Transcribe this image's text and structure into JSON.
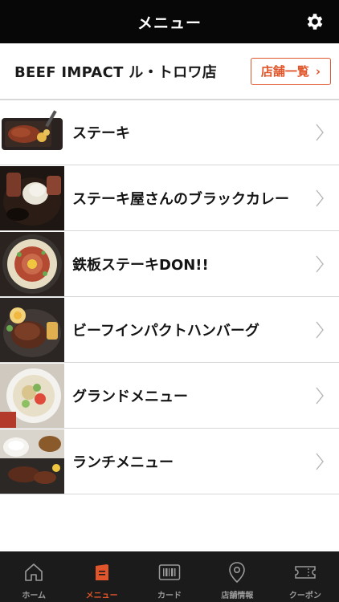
{
  "header": {
    "title": "メニュー"
  },
  "store": {
    "name": "BEEF IMPACT ル・トロワ店",
    "list_button_label": "店舗一覧",
    "list_button_arrow": "›"
  },
  "menu": {
    "items": [
      {
        "label": "ステーキ"
      },
      {
        "label": "ステーキ屋さんのブラックカレー"
      },
      {
        "label": "鉄板ステーキDON!!"
      },
      {
        "label": "ビーフインパクトハンバーグ"
      },
      {
        "label": "グランドメニュー"
      },
      {
        "label": "ランチメニュー"
      }
    ]
  },
  "tabbar": {
    "tabs": [
      {
        "label": "ホーム",
        "icon": "home-icon",
        "active": false
      },
      {
        "label": "メニュー",
        "icon": "menu-book-icon",
        "active": true
      },
      {
        "label": "カード",
        "icon": "barcode-card-icon",
        "active": false
      },
      {
        "label": "店舗情報",
        "icon": "map-pin-icon",
        "active": false
      },
      {
        "label": "クーポン",
        "icon": "ticket-icon",
        "active": false
      }
    ]
  },
  "colors": {
    "accent": "#e0552a",
    "header_bg": "#070707",
    "tabbar_bg": "#1b1b1b",
    "inactive_tab": "#9a9a9a"
  }
}
